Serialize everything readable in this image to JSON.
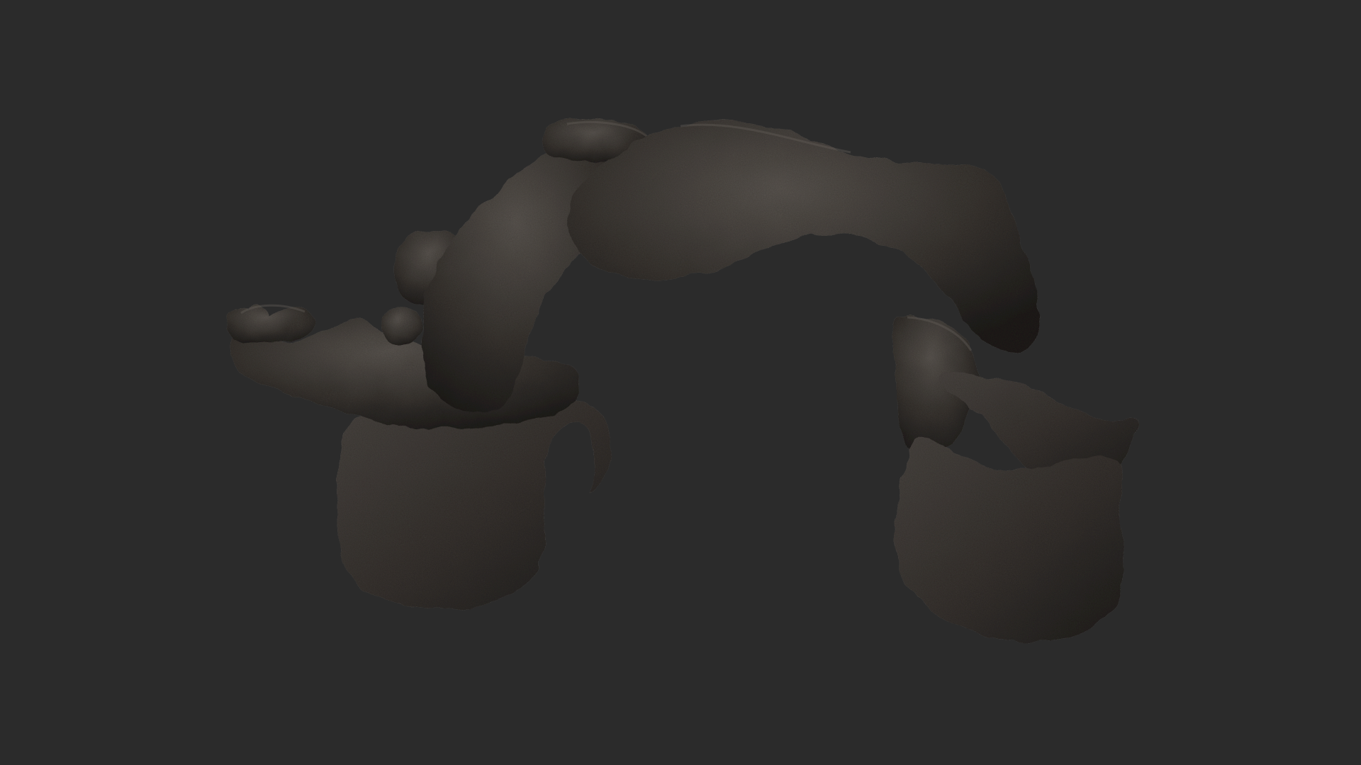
{
  "scene": {
    "background_color": "#2b2b2b",
    "object": "rock-arch",
    "object_base_color": "#3a3632",
    "object_highlight_color": "#5a5550",
    "object_shadow_color": "#1e1c1a"
  }
}
